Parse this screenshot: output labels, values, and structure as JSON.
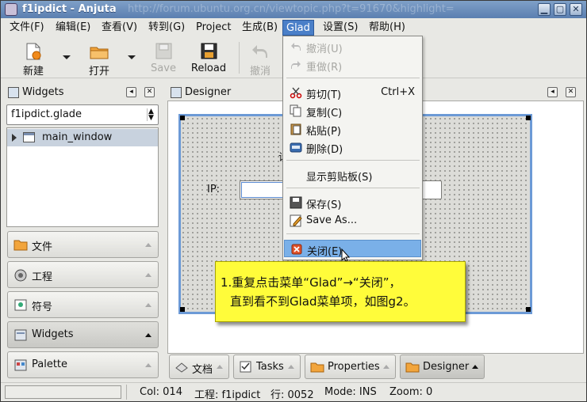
{
  "window": {
    "title": "f1ipdict - Anjuta",
    "url_overlay": "http://forum.ubuntu.org.cn/viewtopic.php?t=91670&highlight=",
    "buttons": [
      "minimize",
      "maximize",
      "close"
    ]
  },
  "menubar": {
    "items": [
      "文件(F)",
      "编辑(E)",
      "查看(V)",
      "转到(G)",
      "Project",
      "生成(B)",
      "Glad",
      "设置(S)",
      "帮助(H)"
    ],
    "active": "Glad"
  },
  "toolbar": {
    "new_label": "新建",
    "open_label": "打开",
    "save_label": "Save",
    "reload_label": "Reload",
    "undo_label": "撤消"
  },
  "left_panel": {
    "header": "Widgets",
    "combo_value": "f1ipdict.glade",
    "tree_item": "main_window",
    "sections": [
      "文件",
      "工程",
      "符号",
      "Widgets",
      "Palette"
    ],
    "active_section": "Widgets"
  },
  "designer": {
    "header": "Designer",
    "ip_label": "IP:",
    "stray_text": "设"
  },
  "glad_menu": {
    "items": [
      {
        "label": "撤消(U)",
        "accel": "",
        "icon": "undo-icon",
        "enabled": false
      },
      {
        "label": "重做(R)",
        "accel": "",
        "icon": "redo-icon",
        "enabled": false
      },
      {
        "label": "剪切(T)",
        "accel": "Ctrl+X",
        "icon": "scissors-icon",
        "enabled": true
      },
      {
        "label": "复制(C)",
        "accel": "",
        "icon": "copy-icon",
        "enabled": true
      },
      {
        "label": "粘贴(P)",
        "accel": "",
        "icon": "paste-icon",
        "enabled": true
      },
      {
        "label": "删除(D)",
        "accel": "",
        "icon": "delete-icon",
        "enabled": true
      },
      {
        "label": "显示剪贴板(S)",
        "accel": "",
        "icon": "",
        "enabled": true
      },
      {
        "label": "保存(S)",
        "accel": "",
        "icon": "save-icon",
        "enabled": true
      },
      {
        "label": "Save As...",
        "accel": "",
        "icon": "save-as-icon",
        "enabled": true
      },
      {
        "label": "关闭(E)",
        "accel": "",
        "icon": "close-red-icon",
        "enabled": true,
        "highlighted": true
      }
    ]
  },
  "callout": {
    "line1": "1.重复点击菜单“Glad”→“关闭”，",
    "line2": "直到看不到Glad菜单项，如图g2。"
  },
  "bottom_tabs": [
    "文档",
    "Tasks",
    "Properties",
    "Designer"
  ],
  "active_bottom_tab": "Designer",
  "statusbar": {
    "col": "Col: 014",
    "project": "工程: f1ipdict",
    "line": "行: 0052",
    "mode": "Mode: INS",
    "zoom": "Zoom: 0"
  },
  "colors": {
    "titlebar": "#5b7fb0",
    "menu_highlight": "#4a7fc8",
    "dropdown_highlight": "#7ab0e8",
    "callout": "#fffc3a",
    "glade_window_border": "#6c9ad6"
  }
}
